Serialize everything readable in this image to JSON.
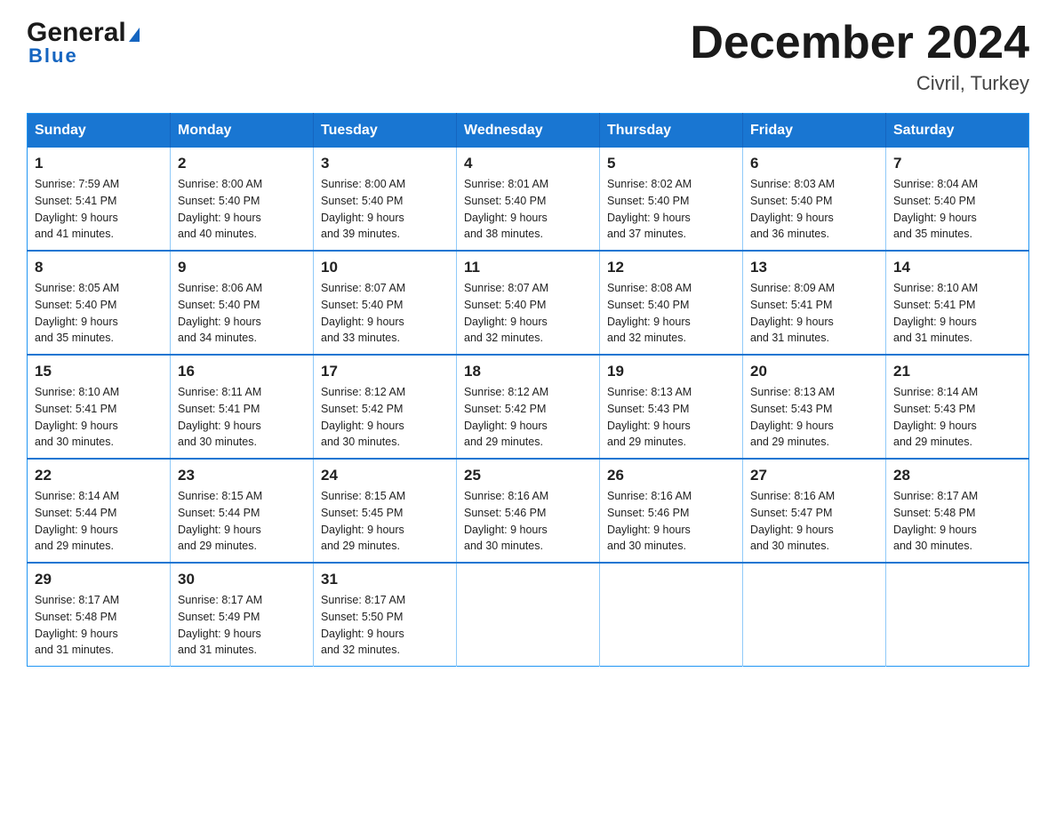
{
  "header": {
    "logo_line1": "General",
    "logo_line2": "Blue",
    "title": "December 2024",
    "location": "Civril, Turkey"
  },
  "days_of_week": [
    "Sunday",
    "Monday",
    "Tuesday",
    "Wednesday",
    "Thursday",
    "Friday",
    "Saturday"
  ],
  "weeks": [
    [
      {
        "day": "1",
        "sunrise": "7:59 AM",
        "sunset": "5:41 PM",
        "daylight": "9 hours and 41 minutes."
      },
      {
        "day": "2",
        "sunrise": "8:00 AM",
        "sunset": "5:40 PM",
        "daylight": "9 hours and 40 minutes."
      },
      {
        "day": "3",
        "sunrise": "8:00 AM",
        "sunset": "5:40 PM",
        "daylight": "9 hours and 39 minutes."
      },
      {
        "day": "4",
        "sunrise": "8:01 AM",
        "sunset": "5:40 PM",
        "daylight": "9 hours and 38 minutes."
      },
      {
        "day": "5",
        "sunrise": "8:02 AM",
        "sunset": "5:40 PM",
        "daylight": "9 hours and 37 minutes."
      },
      {
        "day": "6",
        "sunrise": "8:03 AM",
        "sunset": "5:40 PM",
        "daylight": "9 hours and 36 minutes."
      },
      {
        "day": "7",
        "sunrise": "8:04 AM",
        "sunset": "5:40 PM",
        "daylight": "9 hours and 35 minutes."
      }
    ],
    [
      {
        "day": "8",
        "sunrise": "8:05 AM",
        "sunset": "5:40 PM",
        "daylight": "9 hours and 35 minutes."
      },
      {
        "day": "9",
        "sunrise": "8:06 AM",
        "sunset": "5:40 PM",
        "daylight": "9 hours and 34 minutes."
      },
      {
        "day": "10",
        "sunrise": "8:07 AM",
        "sunset": "5:40 PM",
        "daylight": "9 hours and 33 minutes."
      },
      {
        "day": "11",
        "sunrise": "8:07 AM",
        "sunset": "5:40 PM",
        "daylight": "9 hours and 32 minutes."
      },
      {
        "day": "12",
        "sunrise": "8:08 AM",
        "sunset": "5:40 PM",
        "daylight": "9 hours and 32 minutes."
      },
      {
        "day": "13",
        "sunrise": "8:09 AM",
        "sunset": "5:41 PM",
        "daylight": "9 hours and 31 minutes."
      },
      {
        "day": "14",
        "sunrise": "8:10 AM",
        "sunset": "5:41 PM",
        "daylight": "9 hours and 31 minutes."
      }
    ],
    [
      {
        "day": "15",
        "sunrise": "8:10 AM",
        "sunset": "5:41 PM",
        "daylight": "9 hours and 30 minutes."
      },
      {
        "day": "16",
        "sunrise": "8:11 AM",
        "sunset": "5:41 PM",
        "daylight": "9 hours and 30 minutes."
      },
      {
        "day": "17",
        "sunrise": "8:12 AM",
        "sunset": "5:42 PM",
        "daylight": "9 hours and 30 minutes."
      },
      {
        "day": "18",
        "sunrise": "8:12 AM",
        "sunset": "5:42 PM",
        "daylight": "9 hours and 29 minutes."
      },
      {
        "day": "19",
        "sunrise": "8:13 AM",
        "sunset": "5:43 PM",
        "daylight": "9 hours and 29 minutes."
      },
      {
        "day": "20",
        "sunrise": "8:13 AM",
        "sunset": "5:43 PM",
        "daylight": "9 hours and 29 minutes."
      },
      {
        "day": "21",
        "sunrise": "8:14 AM",
        "sunset": "5:43 PM",
        "daylight": "9 hours and 29 minutes."
      }
    ],
    [
      {
        "day": "22",
        "sunrise": "8:14 AM",
        "sunset": "5:44 PM",
        "daylight": "9 hours and 29 minutes."
      },
      {
        "day": "23",
        "sunrise": "8:15 AM",
        "sunset": "5:44 PM",
        "daylight": "9 hours and 29 minutes."
      },
      {
        "day": "24",
        "sunrise": "8:15 AM",
        "sunset": "5:45 PM",
        "daylight": "9 hours and 29 minutes."
      },
      {
        "day": "25",
        "sunrise": "8:16 AM",
        "sunset": "5:46 PM",
        "daylight": "9 hours and 30 minutes."
      },
      {
        "day": "26",
        "sunrise": "8:16 AM",
        "sunset": "5:46 PM",
        "daylight": "9 hours and 30 minutes."
      },
      {
        "day": "27",
        "sunrise": "8:16 AM",
        "sunset": "5:47 PM",
        "daylight": "9 hours and 30 minutes."
      },
      {
        "day": "28",
        "sunrise": "8:17 AM",
        "sunset": "5:48 PM",
        "daylight": "9 hours and 30 minutes."
      }
    ],
    [
      {
        "day": "29",
        "sunrise": "8:17 AM",
        "sunset": "5:48 PM",
        "daylight": "9 hours and 31 minutes."
      },
      {
        "day": "30",
        "sunrise": "8:17 AM",
        "sunset": "5:49 PM",
        "daylight": "9 hours and 31 minutes."
      },
      {
        "day": "31",
        "sunrise": "8:17 AM",
        "sunset": "5:50 PM",
        "daylight": "9 hours and 32 minutes."
      },
      null,
      null,
      null,
      null
    ]
  ]
}
